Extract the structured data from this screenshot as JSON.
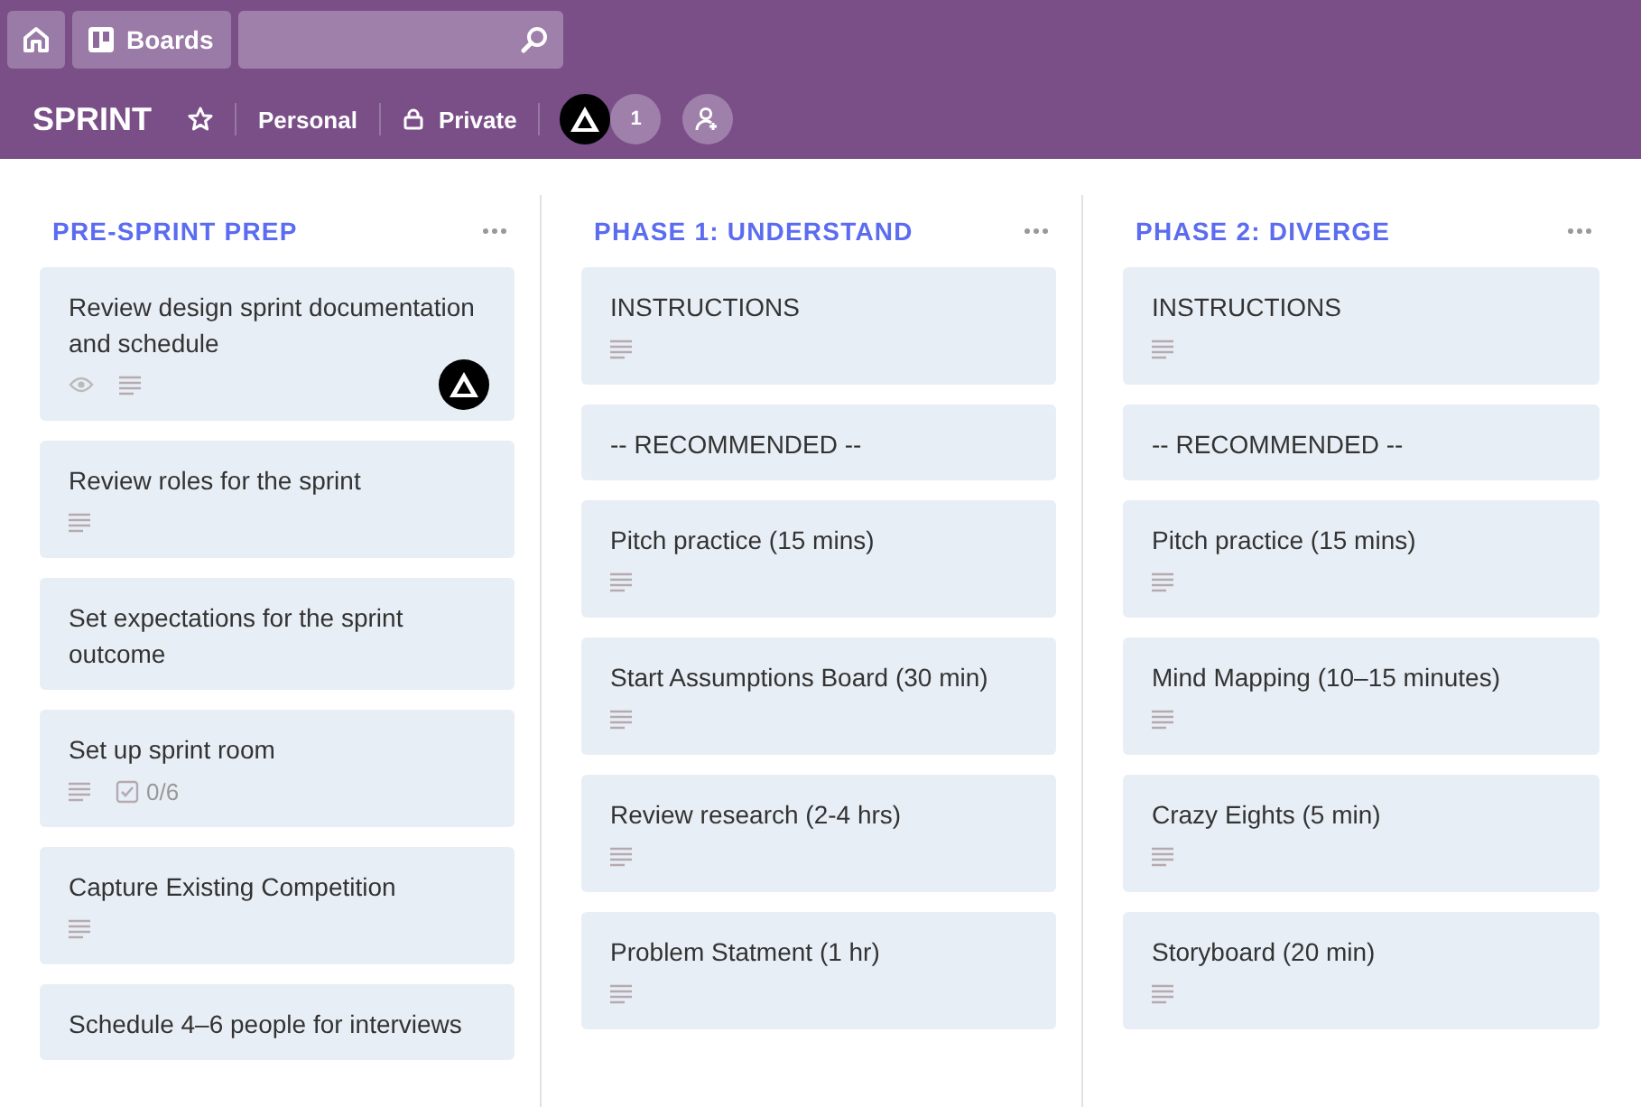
{
  "top_bar": {
    "boards_label": "Boards"
  },
  "board_header": {
    "title": "SPRINT",
    "starred": false,
    "team": "Personal",
    "visibility": "Private",
    "member_count": "1"
  },
  "lists": [
    {
      "title": "PRE-SPRINT PREP",
      "cards": [
        {
          "title": "Review design sprint documentation and schedule",
          "watching": true,
          "has_description": true,
          "member": true
        },
        {
          "title": "Review roles for the sprint",
          "watching": false,
          "has_description": true,
          "member": false
        },
        {
          "title": "Set expectations for the sprint outcome",
          "watching": false,
          "has_description": false,
          "member": false
        },
        {
          "title": "Set up sprint room",
          "watching": false,
          "has_description": true,
          "checklist": "0/6",
          "member": false
        },
        {
          "title": "Capture Existing Competition",
          "watching": false,
          "has_description": true,
          "member": false
        },
        {
          "title": "Schedule 4–6 people for interviews",
          "watching": false,
          "has_description": false,
          "member": false
        }
      ]
    },
    {
      "title": "PHASE 1: UNDERSTAND",
      "cards": [
        {
          "title": "INSTRUCTIONS",
          "watching": false,
          "has_description": true,
          "member": false
        },
        {
          "title": "-- RECOMMENDED --",
          "watching": false,
          "has_description": false,
          "member": false
        },
        {
          "title": "Pitch practice (15 mins)",
          "watching": false,
          "has_description": true,
          "member": false
        },
        {
          "title": "Start Assumptions Board (30 min)",
          "watching": false,
          "has_description": true,
          "member": false
        },
        {
          "title": "Review research (2-4 hrs)",
          "watching": false,
          "has_description": true,
          "member": false
        },
        {
          "title": "Problem Statment (1 hr)",
          "watching": false,
          "has_description": true,
          "member": false
        }
      ]
    },
    {
      "title": "PHASE 2: DIVERGE",
      "cards": [
        {
          "title": "INSTRUCTIONS",
          "watching": false,
          "has_description": true,
          "member": false
        },
        {
          "title": "-- RECOMMENDED --",
          "watching": false,
          "has_description": false,
          "member": false
        },
        {
          "title": "Pitch practice (15 mins)",
          "watching": false,
          "has_description": true,
          "member": false
        },
        {
          "title": "Mind Mapping (10–15 minutes)",
          "watching": false,
          "has_description": true,
          "member": false
        },
        {
          "title": "Crazy Eights (5 min)",
          "watching": false,
          "has_description": true,
          "member": false
        },
        {
          "title": "Storyboard (20 min)",
          "watching": false,
          "has_description": true,
          "member": false
        }
      ]
    }
  ]
}
